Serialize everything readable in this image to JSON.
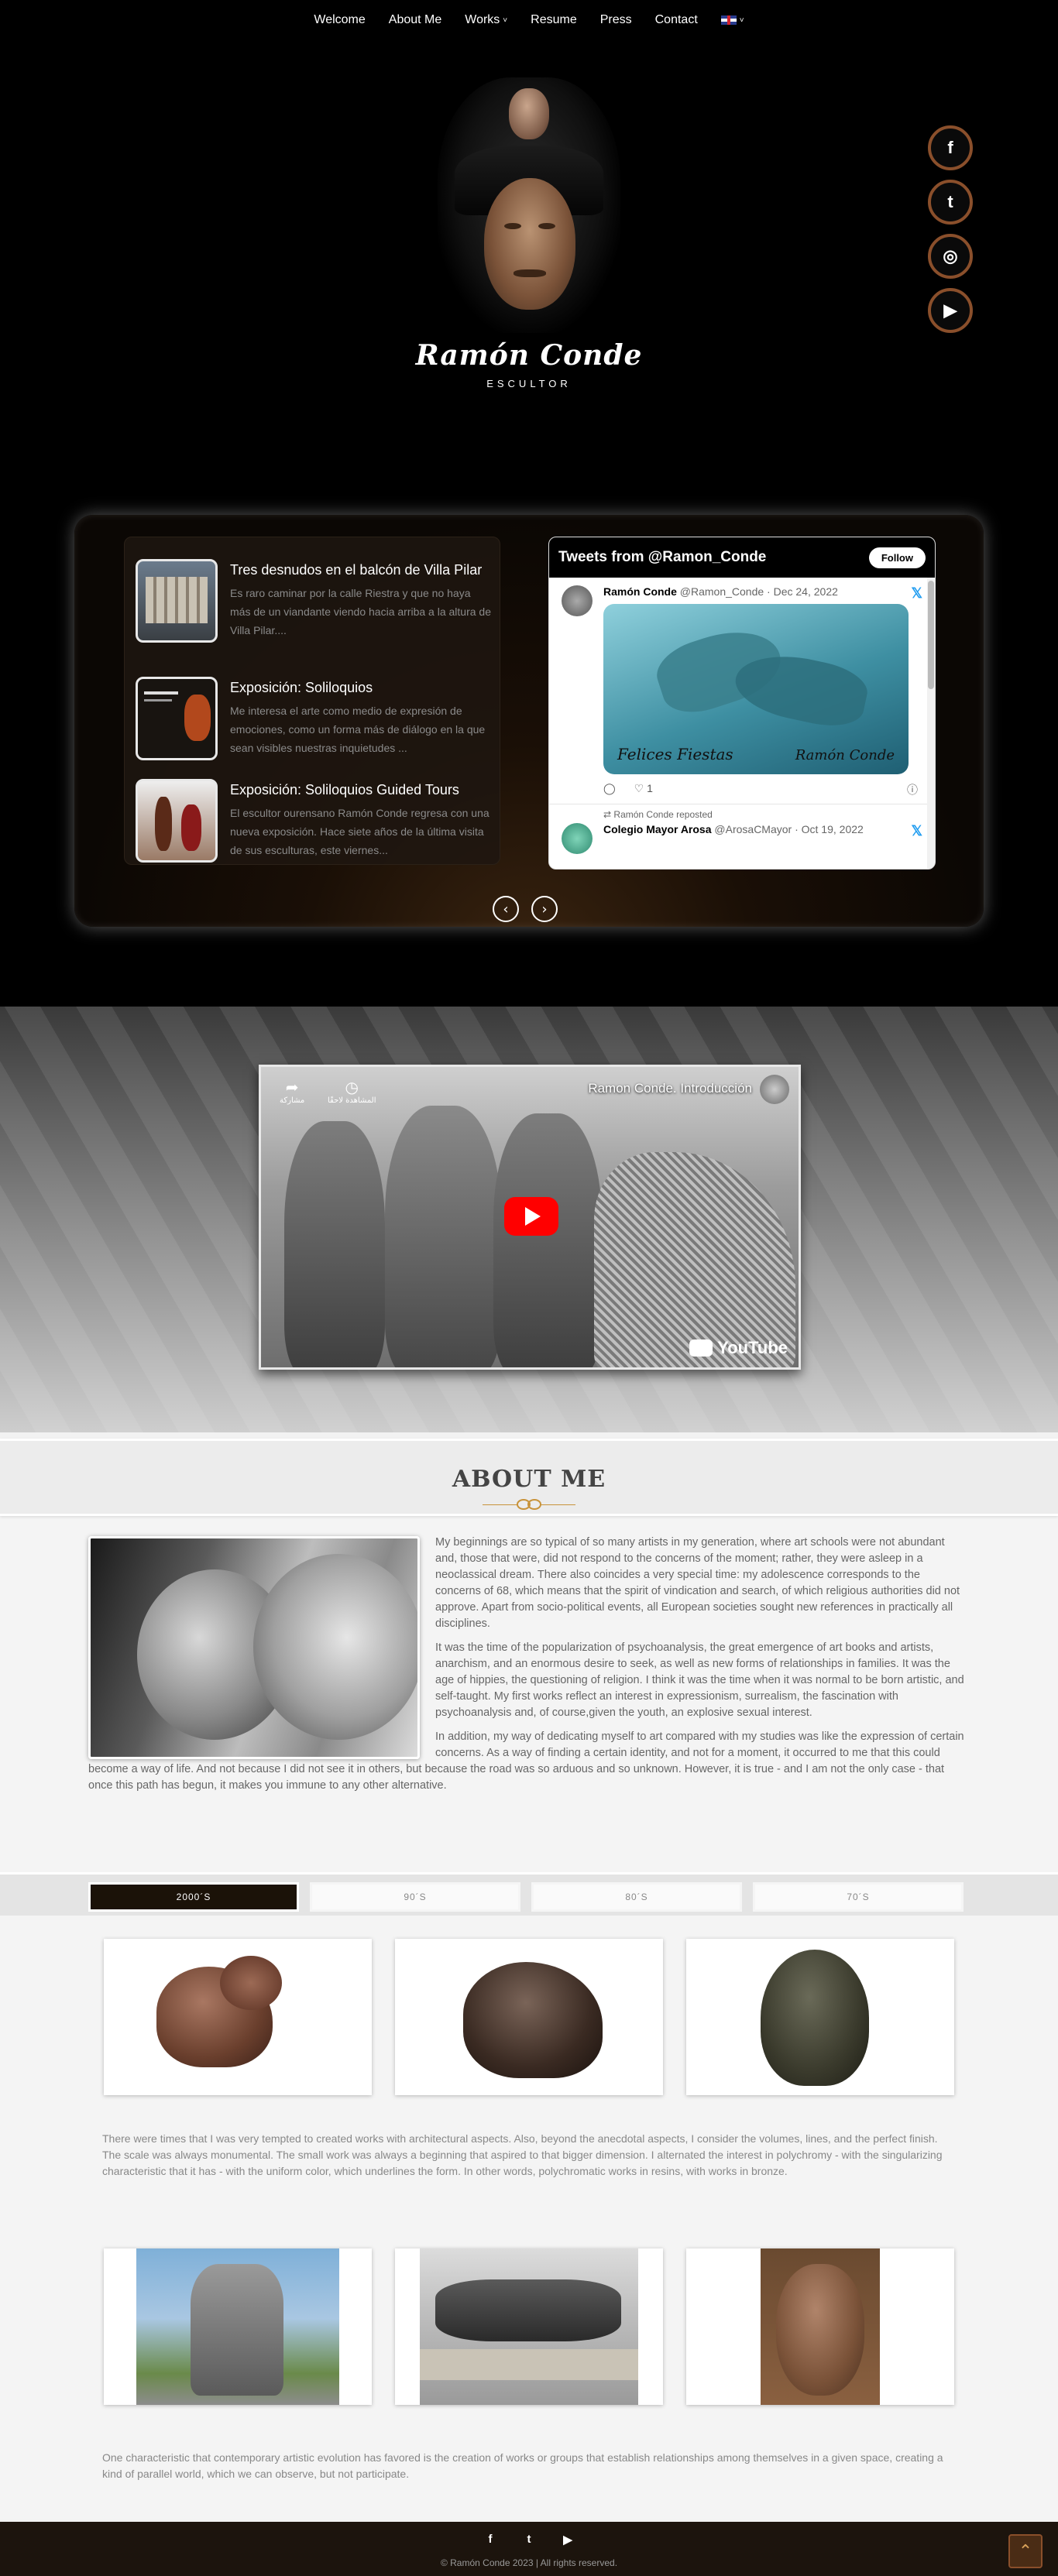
{
  "nav": {
    "items": [
      {
        "label": "Welcome"
      },
      {
        "label": "About Me"
      },
      {
        "label": "Works"
      },
      {
        "label": "Resume"
      },
      {
        "label": "Press"
      },
      {
        "label": "Contact"
      }
    ],
    "dropdown_caret": "˅"
  },
  "hero": {
    "name": "Ramón Conde",
    "subtitle": "ESCULTOR",
    "social": [
      {
        "icon": "facebook-icon",
        "glyph": "f"
      },
      {
        "icon": "twitter-icon",
        "glyph": "t"
      },
      {
        "icon": "instagram-icon",
        "glyph": "◎"
      },
      {
        "icon": "youtube-icon",
        "glyph": "▶"
      }
    ]
  },
  "news": {
    "items": [
      {
        "title": "Tres desnudos en el balcón de Villa Pilar",
        "excerpt": "Es raro caminar por la calle Riestra y que no haya más de un viandante viendo hacia arriba a la altura de Villa Pilar...."
      },
      {
        "title": "Exposición: Soliloquios",
        "excerpt": "Me interesa el arte como medio de expresión de emociones, como un forma más de diálogo en la que sean visibles nuestras inquietudes ..."
      },
      {
        "title": "Exposición: Soliloquios Guided Tours",
        "excerpt": "El escultor ourensano Ramón Conde regresa con una nueva exposición. Hace siete años de la última visita de sus esculturas, este viernes..."
      }
    ]
  },
  "twitter": {
    "header": "Tweets from @Ramon_Conde",
    "follow_label": "Follow",
    "tweet1": {
      "name": "Ramón Conde",
      "handle": "@Ramon_Conde · Dec 24, 2022",
      "media_text_left": "Felices Fiestas",
      "media_text_right": "Ramón Conde",
      "likes": "1"
    },
    "repost_label": "Ramón Conde reposted",
    "tweet2": {
      "name": "Colegio Mayor Arosa",
      "handle": "@ArosaCMayor · Oct 19, 2022"
    }
  },
  "slider": {
    "prev": "‹",
    "next": "›"
  },
  "video": {
    "title": "Ramon Conde. Introducción",
    "share_label": "مشاركة",
    "watch_later_label": "المشاهدة لاحقًا",
    "brand": "YouTube"
  },
  "about": {
    "title": "ABOUT ME",
    "paragraphs": [
      "My beginnings are so typical of so many artists in my generation, where art schools were not abundant and, those that were, did not respond to the concerns of the moment; rather, they were asleep in a neoclassical dream. There also coincides a very special time: my adolescence corresponds to the concerns of 68, which means that the spirit of vindication and search, of which religious authorities did not approve. Apart from socio-political events, all European societies sought new references in practically all disciplines.",
      "It was the time of the popularization of psychoanalysis, the great emergence of art books and artists, anarchism, and an enormous desire to seek, as well as new forms of relationships in families. It was the age of hippies, the questioning of religion. I think it was the time when it was normal to be born artistic, and self-taught. My first works reflect an interest in expressionism, surrealism, the fascination with psychoanalysis and, of course,given the youth, an explosive sexual interest.",
      "In addition, my way of dedicating myself to art compared with my studies was like the expression of certain concerns. As a way of finding a certain identity, and not for a moment, it occurred to me that this could become a way of life. And not because I did not see it in others, but because the road was so arduous and so unknown. However, it is true - and I am not the only case - that once this path has begun, it makes you immune to any other alternative."
    ]
  },
  "tabs": [
    {
      "label": "2000´S",
      "active": true
    },
    {
      "label": "90´S",
      "active": false
    },
    {
      "label": "80´S",
      "active": false
    },
    {
      "label": "70´S",
      "active": false
    }
  ],
  "works": {
    "desc1": "There were times that I was very tempted to created works with architectural aspects. Also, beyond the anecdotal aspects, I consider the volumes, lines, and the perfect finish. The scale was always monumental. The small work was always a beginning that aspired to that bigger dimension. I alternated the interest in polychromy - with the singularizing characteristic that it has - with the uniform color, which underlines the form. In other words, polychromatic works in resins, with works in bronze.",
    "desc2": "One characteristic that contemporary artistic evolution has favored is the creation of works or groups that establish relationships among themselves in a given space, creating a kind of parallel world, which we can observe, but not participate."
  },
  "footer": {
    "copyright": "© Ramón Conde 2023 | All rights reserved.",
    "icons": [
      "facebook-icon",
      "twitter-icon",
      "youtube-icon"
    ],
    "glyphs": [
      "f",
      "t",
      "▶"
    ],
    "to_top": "⌃"
  },
  "colors": {
    "accent": "#8a4f2b",
    "ornament": "#c8933a",
    "tab_active": "#1b1208"
  }
}
